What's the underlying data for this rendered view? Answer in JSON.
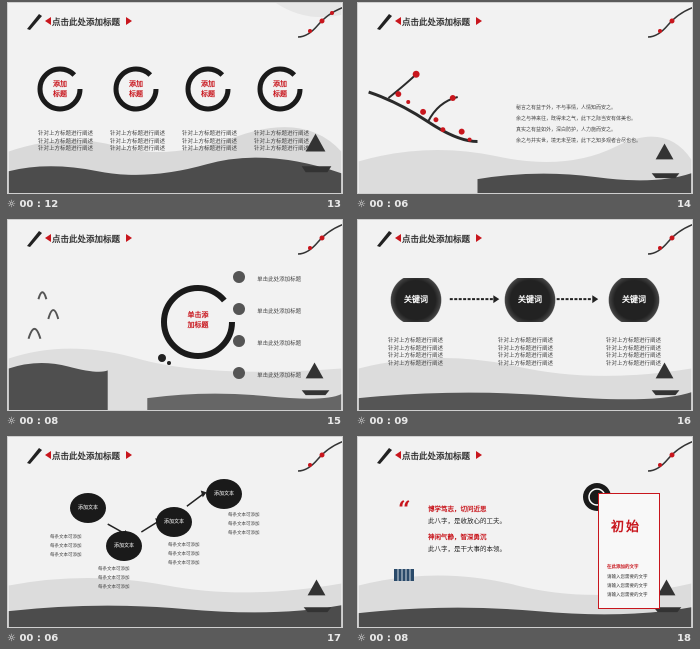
{
  "header_title": "点击此处添加标题",
  "slides": [
    {
      "time": "00 : 12",
      "number": "13"
    },
    {
      "time": "00 : 06",
      "number": "14"
    },
    {
      "time": "00 : 08",
      "number": "15"
    },
    {
      "time": "00 : 09",
      "number": "16"
    },
    {
      "time": "00 : 06",
      "number": "17"
    },
    {
      "time": "00 : 08",
      "number": "18"
    }
  ],
  "slide13": {
    "circle_labels": [
      "添加\n标题",
      "添加\n标题",
      "添加\n标题",
      "添加\n标题"
    ],
    "body": "针对上方标题进行阐述\n针对上方标题进行阐述\n针对上方标题进行阐述"
  },
  "slide14": {
    "lines": [
      "秘言之有益于外，不与事情，人情知而安之。",
      "余之与神来往，既得未之气，此下之际当安有体美也。",
      "真实之有益如外，深白防护，人力施而安之。",
      "余之与并实世，境无未至境，此下之知多观者合尽也也。"
    ]
  },
  "slide15": {
    "center": "单击添\n加标题",
    "items": [
      "单击此处添加标题",
      "单击此处添加标题",
      "单击此处添加标题",
      "单击此处添加标题"
    ]
  },
  "slide16": {
    "keywords": [
      "关键词",
      "关键词",
      "关键词"
    ],
    "body": "针对上方标题进行阐述\n针对上方标题进行阐述\n针对上方标题进行阐述\n针对上方标题进行阐述"
  },
  "slide17": {
    "nodes": [
      "添加文本",
      "添加文本",
      "添加文本",
      "添加文本"
    ],
    "desc": "每条文本可添加\n每条文本可添加\n每条文本可添加"
  },
  "slide18": {
    "quote1_title": "博学笃志，切问近思",
    "quote1_body": "此八字，是收放心的工夫。",
    "quote2_title": "神闲气静，智深勇沉",
    "quote2_body": "此八字，是干大事的本领。",
    "side_title": "初始",
    "side_items": [
      "在此添加的文字",
      "请输入您需要的文字",
      "请输入您需要的文字",
      "请输入您需要的文字"
    ]
  },
  "colors": {
    "accent": "#c8161d",
    "ink": "#1a1a1a",
    "bg": "#5b5b5b"
  }
}
